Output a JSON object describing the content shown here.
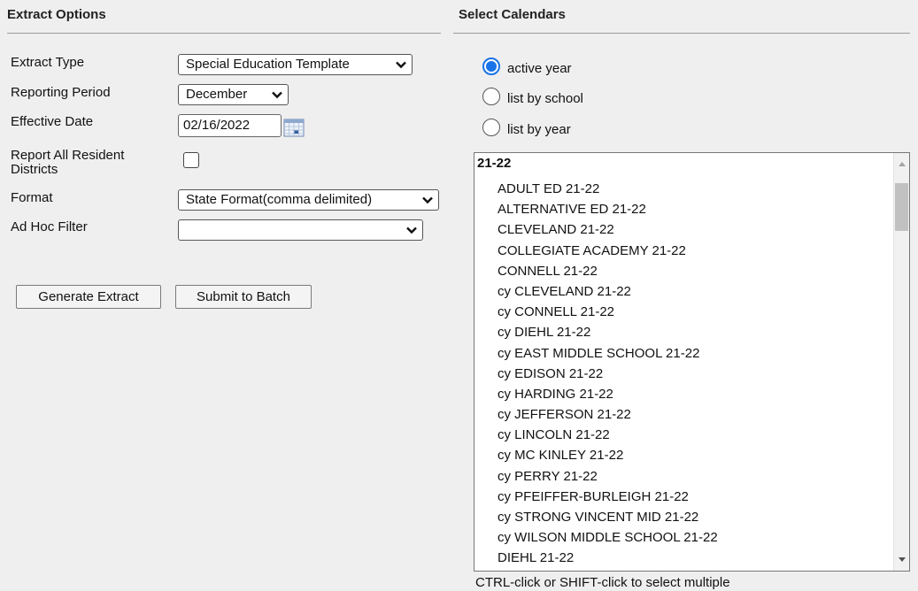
{
  "extract_options": {
    "header": "Extract Options",
    "fields": {
      "extract_type": {
        "label": "Extract Type",
        "value": "Special Education Template"
      },
      "reporting_period": {
        "label": "Reporting Period",
        "value": "December"
      },
      "effective_date": {
        "label": "Effective Date",
        "value": "02/16/2022"
      },
      "report_all_resident_districts": {
        "label_line1": "Report All Resident",
        "label_line2": "Districts",
        "checked": false
      },
      "format": {
        "label": "Format",
        "value": "State Format(comma delimited)"
      },
      "ad_hoc_filter": {
        "label": "Ad Hoc Filter",
        "value": ""
      }
    },
    "buttons": {
      "generate": "Generate Extract",
      "submit_batch": "Submit to Batch"
    }
  },
  "select_calendars": {
    "header": "Select Calendars",
    "radio_options": [
      {
        "label": "active year",
        "checked": true
      },
      {
        "label": "list by school",
        "checked": false
      },
      {
        "label": "list by year",
        "checked": false
      }
    ],
    "group_label": "21-22",
    "calendars": [
      "ADULT ED 21-22",
      "ALTERNATIVE ED 21-22",
      "CLEVELAND 21-22",
      "COLLEGIATE ACADEMY 21-22",
      "CONNELL 21-22",
      "cy CLEVELAND 21-22",
      "cy CONNELL 21-22",
      "cy DIEHL 21-22",
      "cy EAST MIDDLE SCHOOL 21-22",
      "cy EDISON 21-22",
      "cy HARDING 21-22",
      "cy JEFFERSON 21-22",
      "cy LINCOLN 21-22",
      "cy MC KINLEY 21-22",
      "cy PERRY 21-22",
      "cy PFEIFFER-BURLEIGH 21-22",
      "cy STRONG VINCENT MID 21-22",
      "cy WILSON MIDDLE SCHOOL 21-22",
      "DIEHL 21-22"
    ],
    "hint": "CTRL-click or SHIFT-click to select multiple"
  },
  "colors": {
    "radio_accent": "#1a73e8",
    "background": "#efefef"
  },
  "icons": {
    "dropdown": "chevron-down-icon",
    "date_picker": "calendar-icon"
  }
}
